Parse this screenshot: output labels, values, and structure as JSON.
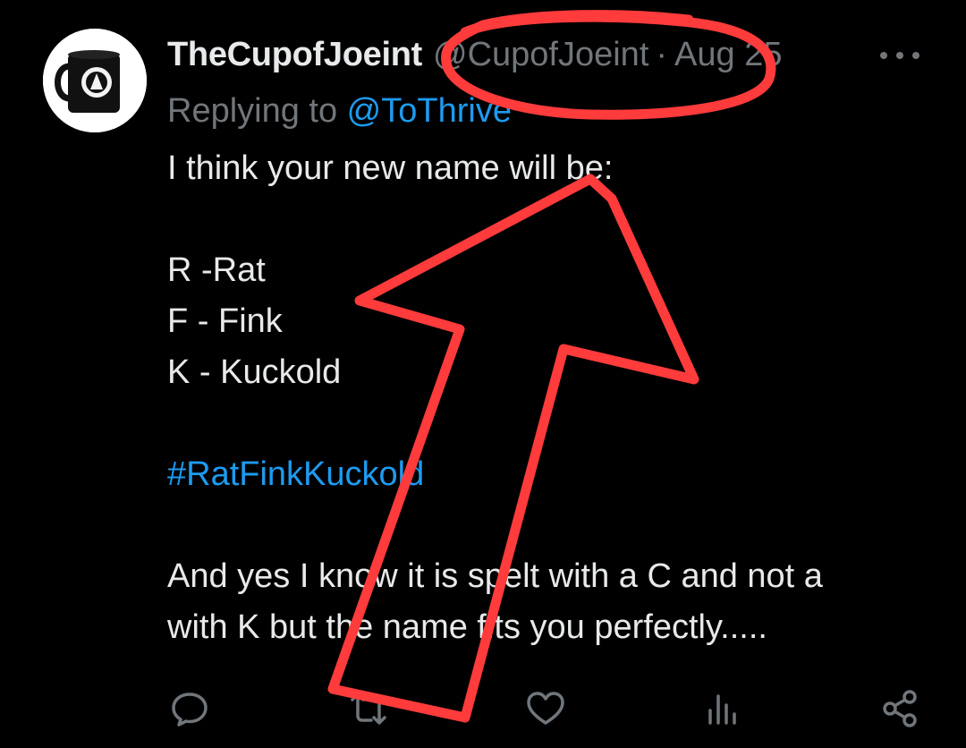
{
  "tweet": {
    "display_name": "TheCupofJoeint",
    "handle": "@CupofJoeint",
    "separator": "·",
    "date": "Aug 25",
    "replying_prefix": "Replying to ",
    "replying_to": "@ToThrive",
    "text_lines": [
      "I think your new name will be:",
      "",
      "R -Rat",
      "F - Fink",
      "K - Kuckold",
      "",
      "#RatFinkKuckold",
      "",
      "And yes I know it is spelt with a C and not a",
      "with K but the name fits you perfectly....."
    ]
  },
  "actions": [
    {
      "name": "reply",
      "icon": "reply-icon"
    },
    {
      "name": "retweet",
      "icon": "retweet-icon"
    },
    {
      "name": "like",
      "icon": "heart-icon"
    },
    {
      "name": "views",
      "icon": "views-chart-icon"
    },
    {
      "name": "share",
      "icon": "share-icon"
    }
  ],
  "colors": {
    "background": "#000000",
    "text": "#e7e9ea",
    "muted": "#71767b",
    "link": "#1d9bf0",
    "annotation": "#ff3b3b"
  }
}
